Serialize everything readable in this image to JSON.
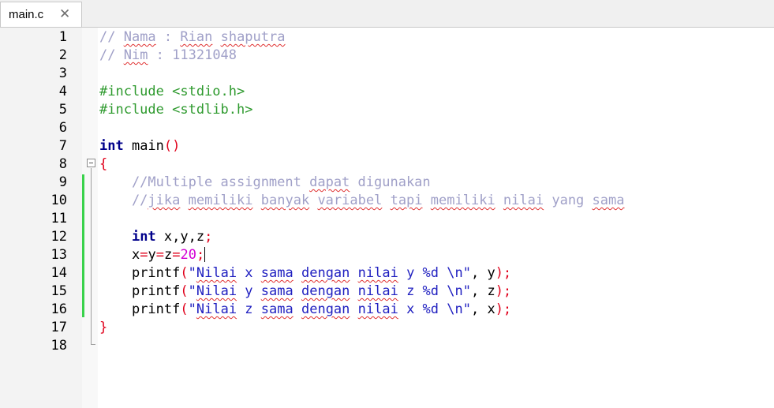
{
  "tab": {
    "label": "main.c",
    "close_glyph": "✕"
  },
  "line_numbers": [
    "1",
    "2",
    "3",
    "4",
    "5",
    "6",
    "7",
    "8",
    "9",
    "10",
    "11",
    "12",
    "13",
    "14",
    "15",
    "16",
    "17",
    "18"
  ],
  "code": {
    "l1": {
      "pre": "// ",
      "a": "Nama",
      "b": " : ",
      "c": "Rian",
      "d": " ",
      "e": "shaputra"
    },
    "l2": {
      "pre": "// ",
      "a": "Nim",
      "b": " : 11321048"
    },
    "l4": "#include <stdio.h>",
    "l5": "#include <stdlib.h>",
    "l7": {
      "kw": "int",
      "name": " main",
      "parens": "()"
    },
    "l8": "{",
    "l9": {
      "a": "    //Multiple assignment ",
      "b": "dapat",
      "c": " digunakan"
    },
    "l10": {
      "a": "    //",
      "b": "jika",
      "c": " ",
      "d": "memiliki",
      "e": " ",
      "f": "banyak",
      "g": " ",
      "h": "variabel",
      "i": " ",
      "j": "tapi",
      "k": " ",
      "l": "memiliki",
      "m": " ",
      "n": "nilai",
      "o": " yang ",
      "p": "sama"
    },
    "l12": {
      "indent": "    ",
      "kw": "int",
      "rest": " x,y,z",
      "semi": ";"
    },
    "l13": {
      "indent": "    ",
      "x": "x",
      "eq1": "=",
      "y": "y",
      "eq2": "=",
      "z": "z",
      "eq3": "=",
      "num": "20",
      "semi": ";"
    },
    "l14": {
      "indent": "    ",
      "fn": "printf",
      "op": "(",
      "q": "\"",
      "w1": "Nilai",
      "s1": " x ",
      "w2": "sama",
      "s2": " ",
      "w3": "dengan",
      "s3": " ",
      "w4": "nilai",
      "s4": " y %d \\n\"",
      "comma": ", y",
      "cl": ");"
    },
    "l15": {
      "indent": "    ",
      "fn": "printf",
      "op": "(",
      "q": "\"",
      "w1": "Nilai",
      "s1": " y ",
      "w2": "sama",
      "s2": " ",
      "w3": "dengan",
      "s3": " ",
      "w4": "nilai",
      "s4": " z %d \\n\"",
      "comma": ", z",
      "cl": ");"
    },
    "l16": {
      "indent": "    ",
      "fn": "printf",
      "op": "(",
      "q": "\"",
      "w1": "Nilai",
      "s1": " z ",
      "w2": "sama",
      "s2": " ",
      "w3": "dengan",
      "s3": " ",
      "w4": "nilai",
      "s4": " x %d \\n\"",
      "comma": ", x",
      "cl": ");"
    },
    "l17": "}"
  },
  "colors": {
    "comment": "#a0a0c8",
    "preprocessor": "#2e9a2e",
    "keyword": "#00008b",
    "operator": "#e0001b",
    "number": "#d400d4",
    "string": "#1f1fc0",
    "change_marker": "#39d24b"
  },
  "icons": {
    "fold": "fold-minus-icon",
    "close": "close-icon"
  }
}
